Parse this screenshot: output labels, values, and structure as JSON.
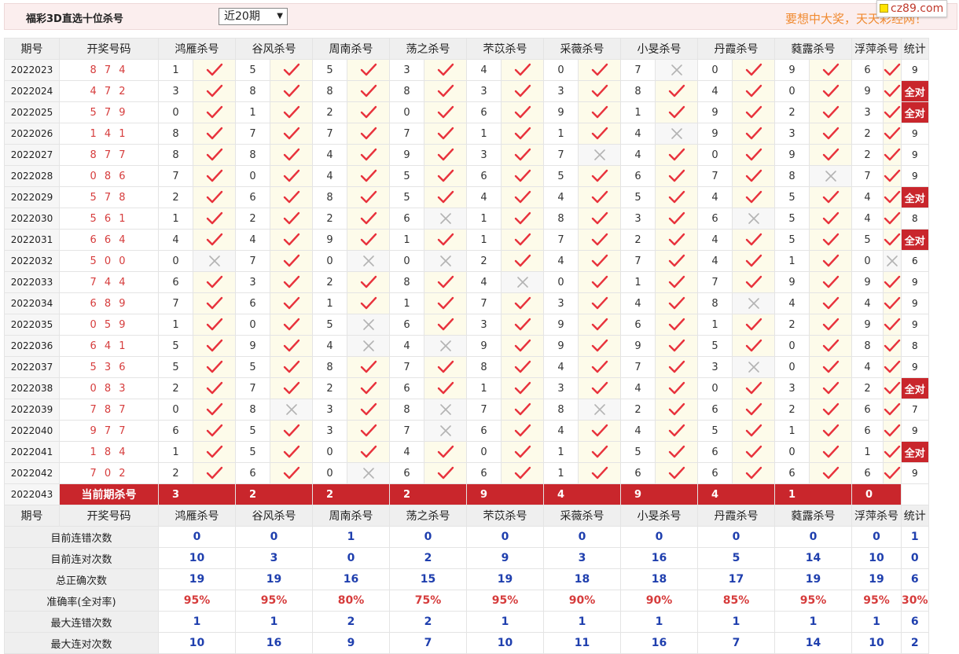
{
  "header": {
    "title": "福彩3D直选十位杀号",
    "period_select": "近20期",
    "slogan": "要想中大奖，天天彩经网！",
    "site_badge": "cz89.com"
  },
  "colors": {
    "accent": "#c9262c",
    "check": "#e8323c",
    "cross": "#b3b3b3",
    "blue": "#1f3fae",
    "red": "#d63c3c"
  },
  "columns": [
    "期号",
    "开奖号码",
    "鸿雁杀号",
    "谷风杀号",
    "周南杀号",
    "荡之杀号",
    "芣苡杀号",
    "采薇杀号",
    "小旻杀号",
    "丹霞杀号",
    "蕤露杀号",
    "浮萍杀号",
    "统计"
  ],
  "rows": [
    {
      "id": "2022023",
      "num": "8 7 4",
      "kills": [
        1,
        5,
        5,
        3,
        4,
        0,
        7,
        0,
        9,
        6
      ],
      "ok": [
        1,
        1,
        1,
        1,
        1,
        1,
        0,
        1,
        1,
        1
      ],
      "stat": "9"
    },
    {
      "id": "2022024",
      "num": "4 7 2",
      "kills": [
        3,
        8,
        8,
        8,
        3,
        3,
        8,
        4,
        0,
        9
      ],
      "ok": [
        1,
        1,
        1,
        1,
        1,
        1,
        1,
        1,
        1,
        1
      ],
      "stat": "全对"
    },
    {
      "id": "2022025",
      "num": "5 7 9",
      "kills": [
        0,
        1,
        2,
        0,
        6,
        9,
        1,
        9,
        2,
        3
      ],
      "ok": [
        1,
        1,
        1,
        1,
        1,
        1,
        1,
        1,
        1,
        1
      ],
      "stat": "全对"
    },
    {
      "id": "2022026",
      "num": "1 4 1",
      "kills": [
        8,
        7,
        7,
        7,
        1,
        1,
        4,
        9,
        3,
        2
      ],
      "ok": [
        1,
        1,
        1,
        1,
        1,
        1,
        0,
        1,
        1,
        1
      ],
      "stat": "9"
    },
    {
      "id": "2022027",
      "num": "8 7 7",
      "kills": [
        8,
        8,
        4,
        9,
        3,
        7,
        4,
        0,
        9,
        2
      ],
      "ok": [
        1,
        1,
        1,
        1,
        1,
        0,
        1,
        1,
        1,
        1
      ],
      "stat": "9"
    },
    {
      "id": "2022028",
      "num": "0 8 6",
      "kills": [
        7,
        0,
        4,
        5,
        6,
        5,
        6,
        7,
        8,
        7
      ],
      "ok": [
        1,
        1,
        1,
        1,
        1,
        1,
        1,
        1,
        0,
        1
      ],
      "stat": "9"
    },
    {
      "id": "2022029",
      "num": "5 7 8",
      "kills": [
        2,
        6,
        8,
        5,
        4,
        4,
        5,
        4,
        5,
        4
      ],
      "ok": [
        1,
        1,
        1,
        1,
        1,
        1,
        1,
        1,
        1,
        1
      ],
      "stat": "全对"
    },
    {
      "id": "2022030",
      "num": "5 6 1",
      "kills": [
        1,
        2,
        2,
        6,
        1,
        8,
        3,
        6,
        5,
        4
      ],
      "ok": [
        1,
        1,
        1,
        0,
        1,
        1,
        1,
        0,
        1,
        1
      ],
      "stat": "8"
    },
    {
      "id": "2022031",
      "num": "6 6 4",
      "kills": [
        4,
        4,
        9,
        1,
        1,
        7,
        2,
        4,
        5,
        5
      ],
      "ok": [
        1,
        1,
        1,
        1,
        1,
        1,
        1,
        1,
        1,
        1
      ],
      "stat": "全对"
    },
    {
      "id": "2022032",
      "num": "5 0 0",
      "kills": [
        0,
        7,
        0,
        0,
        2,
        4,
        7,
        4,
        1,
        0
      ],
      "ok": [
        0,
        1,
        0,
        0,
        1,
        1,
        1,
        1,
        1,
        0
      ],
      "stat": "6"
    },
    {
      "id": "2022033",
      "num": "7 4 4",
      "kills": [
        6,
        3,
        2,
        8,
        4,
        0,
        1,
        7,
        9,
        9
      ],
      "ok": [
        1,
        1,
        1,
        1,
        0,
        1,
        1,
        1,
        1,
        1
      ],
      "stat": "9"
    },
    {
      "id": "2022034",
      "num": "6 8 9",
      "kills": [
        7,
        6,
        1,
        1,
        7,
        3,
        4,
        8,
        4,
        4
      ],
      "ok": [
        1,
        1,
        1,
        1,
        1,
        1,
        1,
        0,
        1,
        1
      ],
      "stat": "9"
    },
    {
      "id": "2022035",
      "num": "0 5 9",
      "kills": [
        1,
        0,
        5,
        6,
        3,
        9,
        6,
        1,
        2,
        9
      ],
      "ok": [
        1,
        1,
        0,
        1,
        1,
        1,
        1,
        1,
        1,
        1
      ],
      "stat": "9"
    },
    {
      "id": "2022036",
      "num": "6 4 1",
      "kills": [
        5,
        9,
        4,
        4,
        9,
        9,
        9,
        5,
        0,
        8
      ],
      "ok": [
        1,
        1,
        0,
        0,
        1,
        1,
        1,
        1,
        1,
        1
      ],
      "stat": "8"
    },
    {
      "id": "2022037",
      "num": "5 3 6",
      "kills": [
        5,
        5,
        8,
        7,
        8,
        4,
        7,
        3,
        0,
        4
      ],
      "ok": [
        1,
        1,
        1,
        1,
        1,
        1,
        1,
        0,
        1,
        1
      ],
      "stat": "9"
    },
    {
      "id": "2022038",
      "num": "0 8 3",
      "kills": [
        2,
        7,
        2,
        6,
        1,
        3,
        4,
        0,
        3,
        2
      ],
      "ok": [
        1,
        1,
        1,
        1,
        1,
        1,
        1,
        1,
        1,
        1
      ],
      "stat": "全对"
    },
    {
      "id": "2022039",
      "num": "7 8 7",
      "kills": [
        0,
        8,
        3,
        8,
        7,
        8,
        2,
        6,
        2,
        6
      ],
      "ok": [
        1,
        0,
        1,
        0,
        1,
        0,
        1,
        1,
        1,
        1
      ],
      "stat": "7"
    },
    {
      "id": "2022040",
      "num": "9 7 7",
      "kills": [
        6,
        5,
        3,
        7,
        6,
        4,
        4,
        5,
        1,
        6
      ],
      "ok": [
        1,
        1,
        1,
        0,
        1,
        1,
        1,
        1,
        1,
        1
      ],
      "stat": "9"
    },
    {
      "id": "2022041",
      "num": "1 8 4",
      "kills": [
        1,
        5,
        0,
        4,
        0,
        1,
        5,
        6,
        0,
        1
      ],
      "ok": [
        1,
        1,
        1,
        1,
        1,
        1,
        1,
        1,
        1,
        1
      ],
      "stat": "全对"
    },
    {
      "id": "2022042",
      "num": "7 0 2",
      "kills": [
        2,
        6,
        0,
        6,
        6,
        1,
        6,
        6,
        6,
        6
      ],
      "ok": [
        1,
        1,
        0,
        1,
        1,
        1,
        1,
        1,
        1,
        1
      ],
      "stat": "9"
    }
  ],
  "current": {
    "id": "2022043",
    "label": "当前期杀号",
    "kills": [
      3,
      2,
      2,
      2,
      9,
      4,
      9,
      4,
      1,
      0
    ]
  },
  "summary": [
    {
      "label": "目前连错次数",
      "color": "blue",
      "values": [
        "0",
        "0",
        "1",
        "0",
        "0",
        "0",
        "0",
        "0",
        "0",
        "0"
      ],
      "stat": "1"
    },
    {
      "label": "目前连对次数",
      "color": "blue",
      "values": [
        "10",
        "3",
        "0",
        "2",
        "9",
        "3",
        "16",
        "5",
        "14",
        "10"
      ],
      "stat": "0"
    },
    {
      "label": "总正确次数",
      "color": "blue",
      "values": [
        "19",
        "19",
        "16",
        "15",
        "19",
        "18",
        "18",
        "17",
        "19",
        "19"
      ],
      "stat": "6"
    },
    {
      "label": "准确率(全对率)",
      "color": "red",
      "values": [
        "95%",
        "95%",
        "80%",
        "75%",
        "95%",
        "90%",
        "90%",
        "85%",
        "95%",
        "95%"
      ],
      "stat": "30%"
    },
    {
      "label": "最大连错次数",
      "color": "blue",
      "values": [
        "1",
        "1",
        "2",
        "2",
        "1",
        "1",
        "1",
        "1",
        "1",
        "1"
      ],
      "stat": "6"
    },
    {
      "label": "最大连对次数",
      "color": "blue",
      "values": [
        "10",
        "16",
        "9",
        "7",
        "10",
        "11",
        "16",
        "7",
        "14",
        "10"
      ],
      "stat": "2"
    }
  ]
}
